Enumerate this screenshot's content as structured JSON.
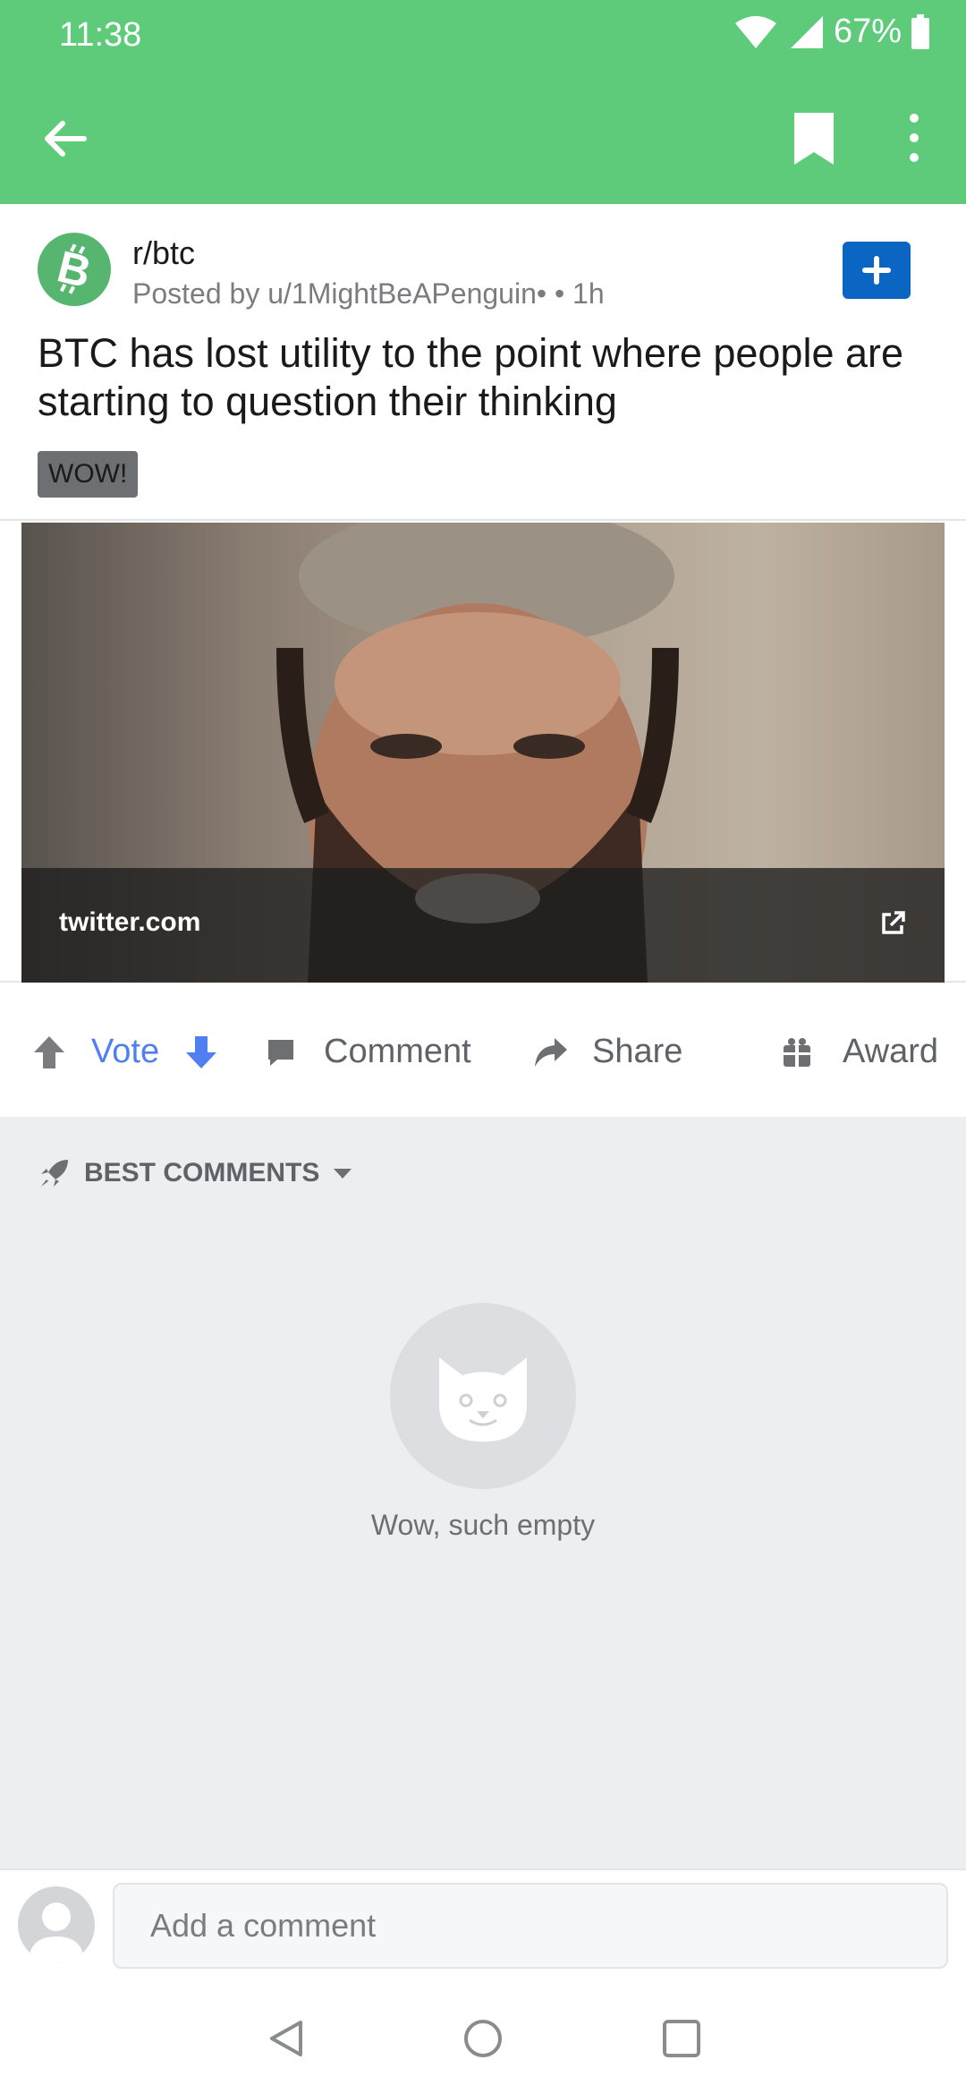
{
  "status_bar": {
    "time": "11:38",
    "battery": "67%"
  },
  "app_bar": {
    "back_icon": "arrow-left-icon",
    "bookmark_icon": "bookmark-icon",
    "more_icon": "more-vert-icon"
  },
  "post": {
    "subreddit": "r/btc",
    "posted_by": "Posted by u/1MightBeAPenguin•  • 1h",
    "title": "BTC has lost utility to the point where people are starting to question their thinking",
    "flair": "WOW!",
    "link_domain": "twitter.com"
  },
  "actions": {
    "vote_label": "Vote",
    "comment_label": "Comment",
    "share_label": "Share",
    "award_label": "Award"
  },
  "comments": {
    "sort_label": "BEST COMMENTS",
    "empty_text": "Wow, such empty"
  },
  "compose": {
    "placeholder": "Add a comment"
  },
  "colors": {
    "app_bar": "#5ecb7a",
    "accent_blue": "#0a66c2",
    "vote_blue": "#4f7ff0"
  }
}
